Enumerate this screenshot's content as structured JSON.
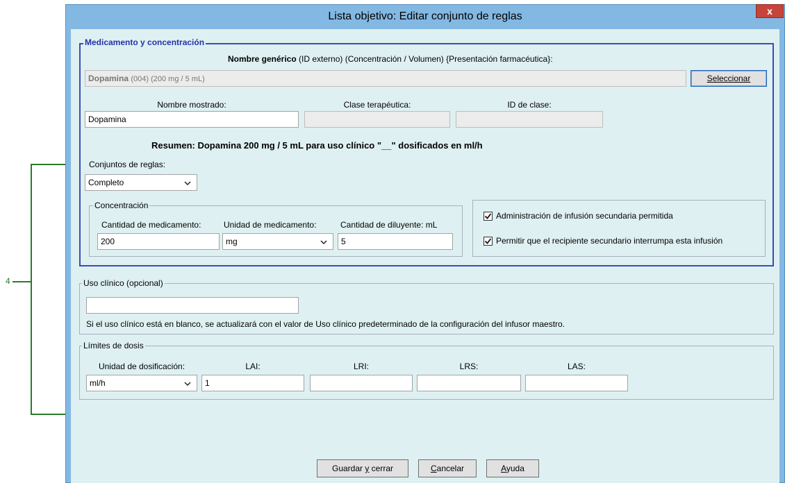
{
  "window": {
    "title": "Lista objetivo: Editar conjunto de reglas",
    "close_label": "x"
  },
  "callout": {
    "label": "4",
    "color": "#2a7a2a"
  },
  "medication": {
    "legend": "Medicamento y concentración",
    "header_bold": "Nombre genérico",
    "header_rest": "(ID externo) (Concentración / Volumen) {Presentación farmacéutica}:",
    "generic_name_bold": "Dopamina",
    "generic_name_rest": "(004) (200 mg / 5 mL)",
    "select_button": "Seleccionar",
    "display_name_label": "Nombre mostrado:",
    "display_name_value": "Dopamina",
    "therapeutic_class_label": "Clase terapéutica:",
    "therapeutic_class_value": "",
    "class_id_label": "ID de clase:",
    "class_id_value": "",
    "summary": "Resumen: Dopamina 200 mg / 5 mL para uso clínico \"__\" dosificados en ml/h",
    "rule_sets_label": "Conjuntos de reglas:",
    "rule_sets_value": "Completo"
  },
  "concentration": {
    "legend": "Concentración",
    "drug_amount_label": "Cantidad de medicamento:",
    "drug_amount_value": "200",
    "drug_unit_label": "Unidad de medicamento:",
    "drug_unit_value": "mg",
    "diluent_label": "Cantidad de diluyente: mL",
    "diluent_value": "5"
  },
  "secondary": {
    "allowed_label": "Administración de infusión secundaria permitida",
    "allowed_checked": true,
    "interrupt_label": "Permitir que el recipiente secundario interrumpa esta infusión",
    "interrupt_checked": true
  },
  "clinical_use": {
    "legend": "Uso clínico (opcional)",
    "value": "",
    "note": "Si el uso clínico está en blanco, se actualizará con el valor de Uso clínico predeterminado de la configuración del infusor maestro."
  },
  "dose_limits": {
    "legend": "Límites de dosis",
    "unit_label": "Unidad de dosificación:",
    "unit_value": "ml/h",
    "lai_label": "LAI:",
    "lai_value": "1",
    "lri_label": "LRI:",
    "lri_value": "",
    "lrs_label": "LRS:",
    "lrs_value": "",
    "las_label": "LAS:",
    "las_value": ""
  },
  "buttons": {
    "save_pre": "Guardar ",
    "save_u": "y",
    "save_post": " cerrar",
    "cancel_u": "C",
    "cancel_post": "ancelar",
    "help_u": "A",
    "help_post": "yuda"
  }
}
